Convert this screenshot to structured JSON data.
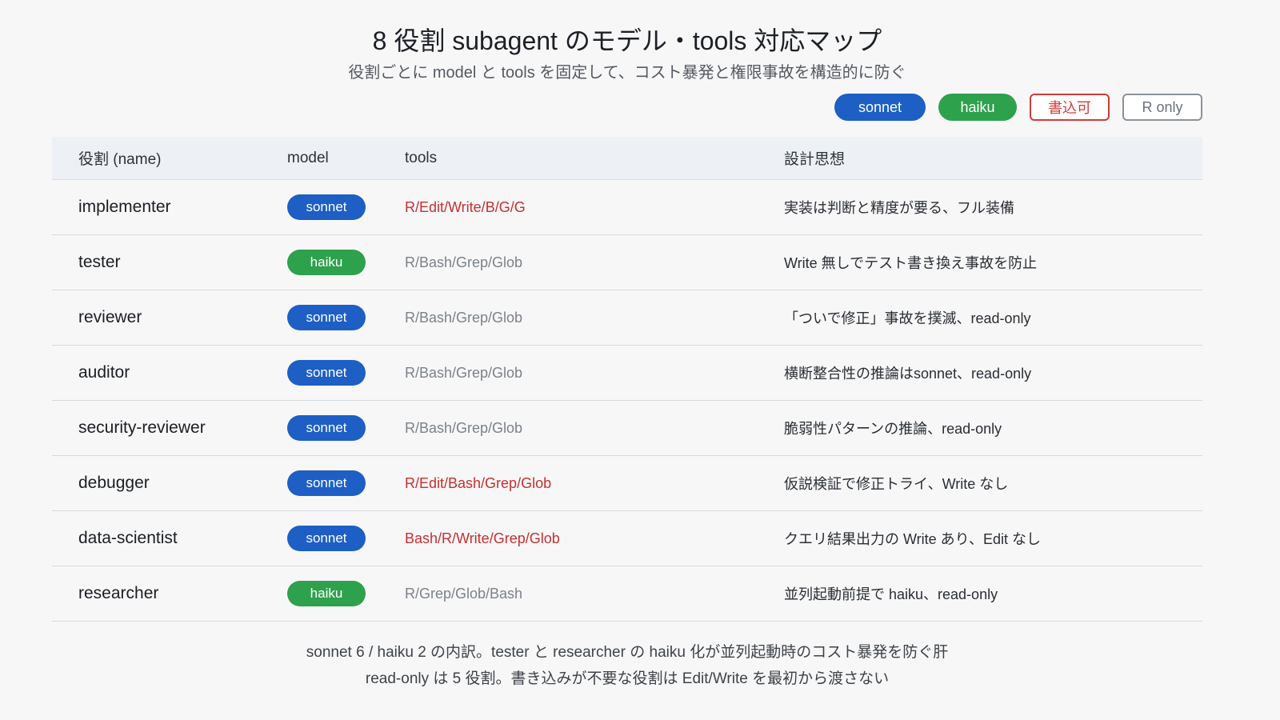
{
  "header": {
    "title": "8 役割 subagent のモデル・tools 対応マップ",
    "subtitle": "役割ごとに model と tools を固定して、コスト暴発と権限事故を構造的に防ぐ"
  },
  "legend": {
    "sonnet": "sonnet",
    "haiku": "haiku",
    "write": "書込可",
    "read": "R only"
  },
  "colors": {
    "sonnet": "#1d5fc4",
    "haiku": "#2ea14c",
    "write": "#c82f2f",
    "read": "#7c8288"
  },
  "table": {
    "headers": {
      "name": "役割 (name)",
      "model": "model",
      "tools": "tools",
      "design": "設計思想"
    },
    "rows": [
      {
        "name": "implementer",
        "model": "sonnet",
        "tools": "R/Edit/Write/B/G/G",
        "access": "write",
        "design": "実装は判断と精度が要る、フル装備"
      },
      {
        "name": "tester",
        "model": "haiku",
        "tools": "R/Bash/Grep/Glob",
        "access": "read",
        "design": "Write 無しでテスト書き換え事故を防止"
      },
      {
        "name": "reviewer",
        "model": "sonnet",
        "tools": "R/Bash/Grep/Glob",
        "access": "read",
        "design": "「ついで修正」事故を撲滅、read-only"
      },
      {
        "name": "auditor",
        "model": "sonnet",
        "tools": "R/Bash/Grep/Glob",
        "access": "read",
        "design": "横断整合性の推論はsonnet、read-only"
      },
      {
        "name": "security-reviewer",
        "model": "sonnet",
        "tools": "R/Bash/Grep/Glob",
        "access": "read",
        "design": "脆弱性パターンの推論、read-only"
      },
      {
        "name": "debugger",
        "model": "sonnet",
        "tools": "R/Edit/Bash/Grep/Glob",
        "access": "write",
        "design": "仮説検証で修正トライ、Write なし"
      },
      {
        "name": "data-scientist",
        "model": "sonnet",
        "tools": "Bash/R/Write/Grep/Glob",
        "access": "write",
        "design": "クエリ結果出力の Write あり、Edit なし"
      },
      {
        "name": "researcher",
        "model": "haiku",
        "tools": "R/Grep/Glob/Bash",
        "access": "read",
        "design": "並列起動前提で haiku、read-only"
      }
    ]
  },
  "footer": {
    "line1": "sonnet 6 / haiku 2 の内訳。tester と researcher の haiku 化が並列起動時のコスト暴発を防ぐ肝",
    "line2": "read-only は 5 役割。書き込みが不要な役割は Edit/Write を最初から渡さない"
  }
}
